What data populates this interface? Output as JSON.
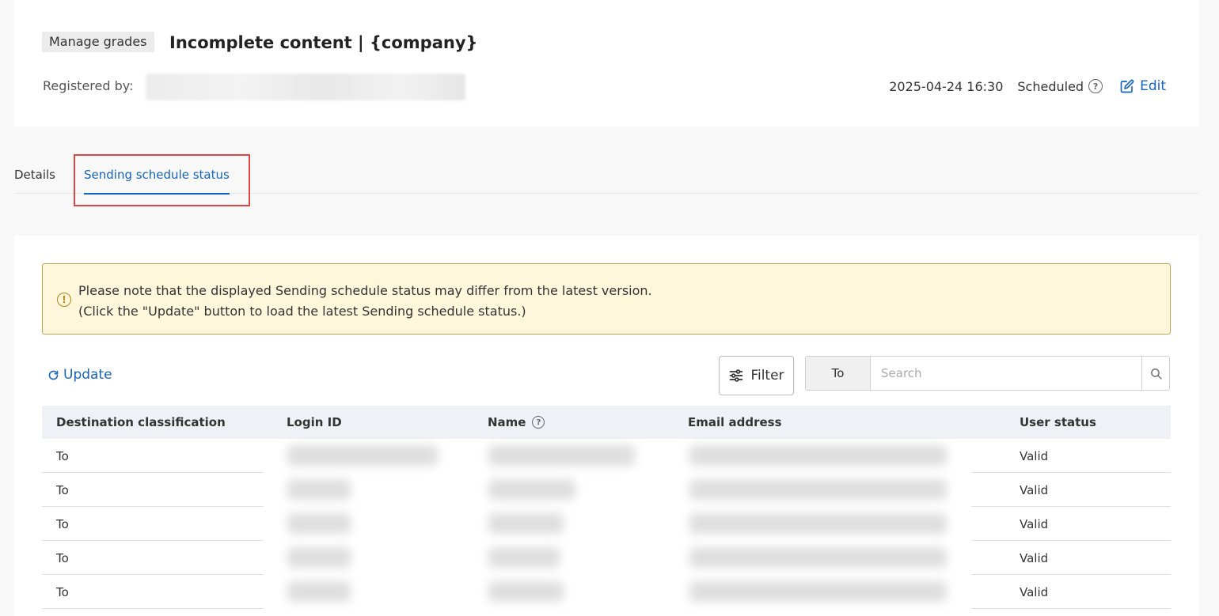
{
  "header": {
    "badge": "Manage grades",
    "title": "Incomplete content | {company}",
    "registered_label": "Registered by:",
    "datetime": "2025-04-24 16:30",
    "status": "Scheduled",
    "help_glyph": "?",
    "edit_label": "Edit"
  },
  "tabs": [
    {
      "label": "Details"
    },
    {
      "label": "Sending schedule status"
    }
  ],
  "notice": {
    "icon_glyph": "!",
    "line1": "Please note that the displayed Sending schedule status may differ from the latest version.",
    "line2": "(Click the \"Update\" button to load the latest Sending schedule status.)"
  },
  "toolbar": {
    "update_label": "Update",
    "filter_label": "Filter",
    "search_scope": "To",
    "search_placeholder": "Search"
  },
  "table": {
    "columns": [
      "Destination classification",
      "Login ID",
      "Name",
      "Email address",
      "User status"
    ],
    "name_help_glyph": "?",
    "rows": [
      {
        "classification": "To",
        "status": "Valid"
      },
      {
        "classification": "To",
        "status": "Valid"
      },
      {
        "classification": "To",
        "status": "Valid"
      },
      {
        "classification": "To",
        "status": "Valid"
      },
      {
        "classification": "To",
        "status": "Valid"
      }
    ]
  },
  "colors": {
    "accent": "#1565c0",
    "highlight_border": "#e04646",
    "notice_bg": "#fef7dc",
    "notice_border": "#c8a24a"
  }
}
